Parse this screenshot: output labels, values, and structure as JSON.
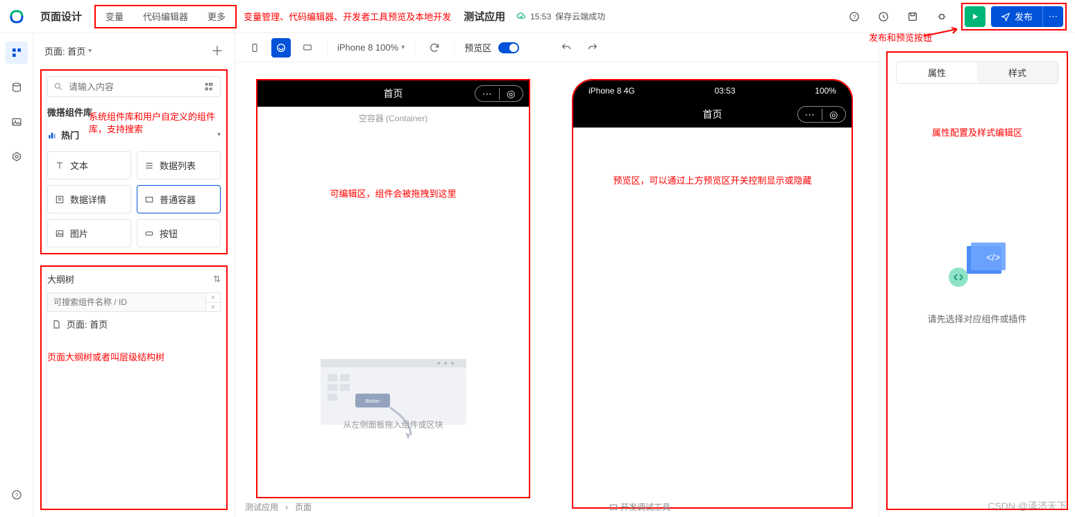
{
  "top": {
    "title": "页面设计",
    "links": [
      "变量",
      "代码编辑器",
      "更多"
    ],
    "desc": "变量管理、代码编辑器、开发者工具预览及本地开发",
    "app_name": "测试应用",
    "cloud_time": "15:53",
    "cloud_status": "保存云端成功",
    "publish": "发布"
  },
  "annotations": {
    "publish_hint": "发布和预览按钮",
    "lib_hint": "系统组件库和用户自定义的组件库，支持搜索",
    "edit_hint": "可编辑区，组件会被拖拽到这里",
    "preview_hint": "预览区，可以通过上方预览区开关控制显示或隐藏",
    "outline_hint": "页面大纲树或者叫层级结构树",
    "right_hint": "属性配置及样式编辑区"
  },
  "left": {
    "page_label": "页面: 首页",
    "search_placeholder": "请输入内容",
    "lib_title": "微搭组件库",
    "hot_label": "热门",
    "components": [
      "文本",
      "数据列表",
      "数据详情",
      "普通容器",
      "图片",
      "按钮"
    ],
    "outline_title": "大纲树",
    "outline_search_placeholder": "可搜索组件名称 / ID",
    "outline_root": "页面: 首页"
  },
  "toolbar": {
    "device": "iPhone 8 100%",
    "preview_label": "预览区"
  },
  "editor": {
    "title": "首页",
    "container_label": "空容器 (Container)",
    "drop_hint": "从左侧面板拖入组件或区块"
  },
  "preview": {
    "carrier": "iPhone 8  4G",
    "time": "03:53",
    "battery": "100%",
    "title": "首页"
  },
  "breadcrumb": {
    "app": "测试应用",
    "page": "页面",
    "debug": "开发调试工具"
  },
  "right": {
    "tab_attr": "属性",
    "tab_style": "样式",
    "empty": "请先选择对应组件或插件"
  },
  "watermark": "CSDN @泽济天下"
}
